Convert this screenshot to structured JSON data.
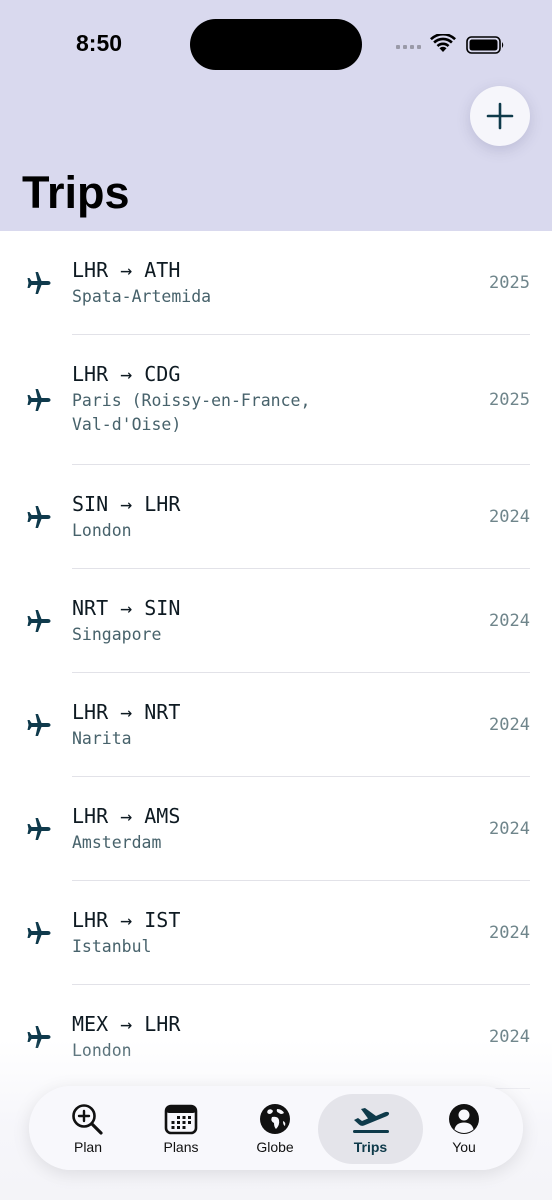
{
  "status_bar": {
    "time": "8:50"
  },
  "header": {
    "title": "Trips",
    "add_icon": "plus-icon"
  },
  "trips": [
    {
      "route": "LHR → ATH",
      "city": "Spata-Artemida",
      "year": "2025"
    },
    {
      "route": "LHR → CDG",
      "city": "Paris (Roissy-en-France, Val-d'Oise)",
      "year": "2025"
    },
    {
      "route": "SIN → LHR",
      "city": "London",
      "year": "2024"
    },
    {
      "route": "NRT → SIN",
      "city": "Singapore",
      "year": "2024"
    },
    {
      "route": "LHR → NRT",
      "city": "Narita",
      "year": "2024"
    },
    {
      "route": "LHR → AMS",
      "city": "Amsterdam",
      "year": "2024"
    },
    {
      "route": "LHR → IST",
      "city": "Istanbul",
      "year": "2024"
    },
    {
      "route": "MEX → LHR",
      "city": "London",
      "year": "2024"
    }
  ],
  "tabbar": {
    "tabs": [
      {
        "label": "Plan",
        "icon": "magnifier-plus-icon"
      },
      {
        "label": "Plans",
        "icon": "calendar-icon"
      },
      {
        "label": "Globe",
        "icon": "globe-icon"
      },
      {
        "label": "Trips",
        "icon": "plane-departure-icon"
      },
      {
        "label": "You",
        "icon": "person-circle-icon"
      }
    ],
    "active": "Trips"
  },
  "colors": {
    "header_bg": "#d9d9ee",
    "accent": "#0e3a4a",
    "plane_icon": "#0f3a4c"
  }
}
